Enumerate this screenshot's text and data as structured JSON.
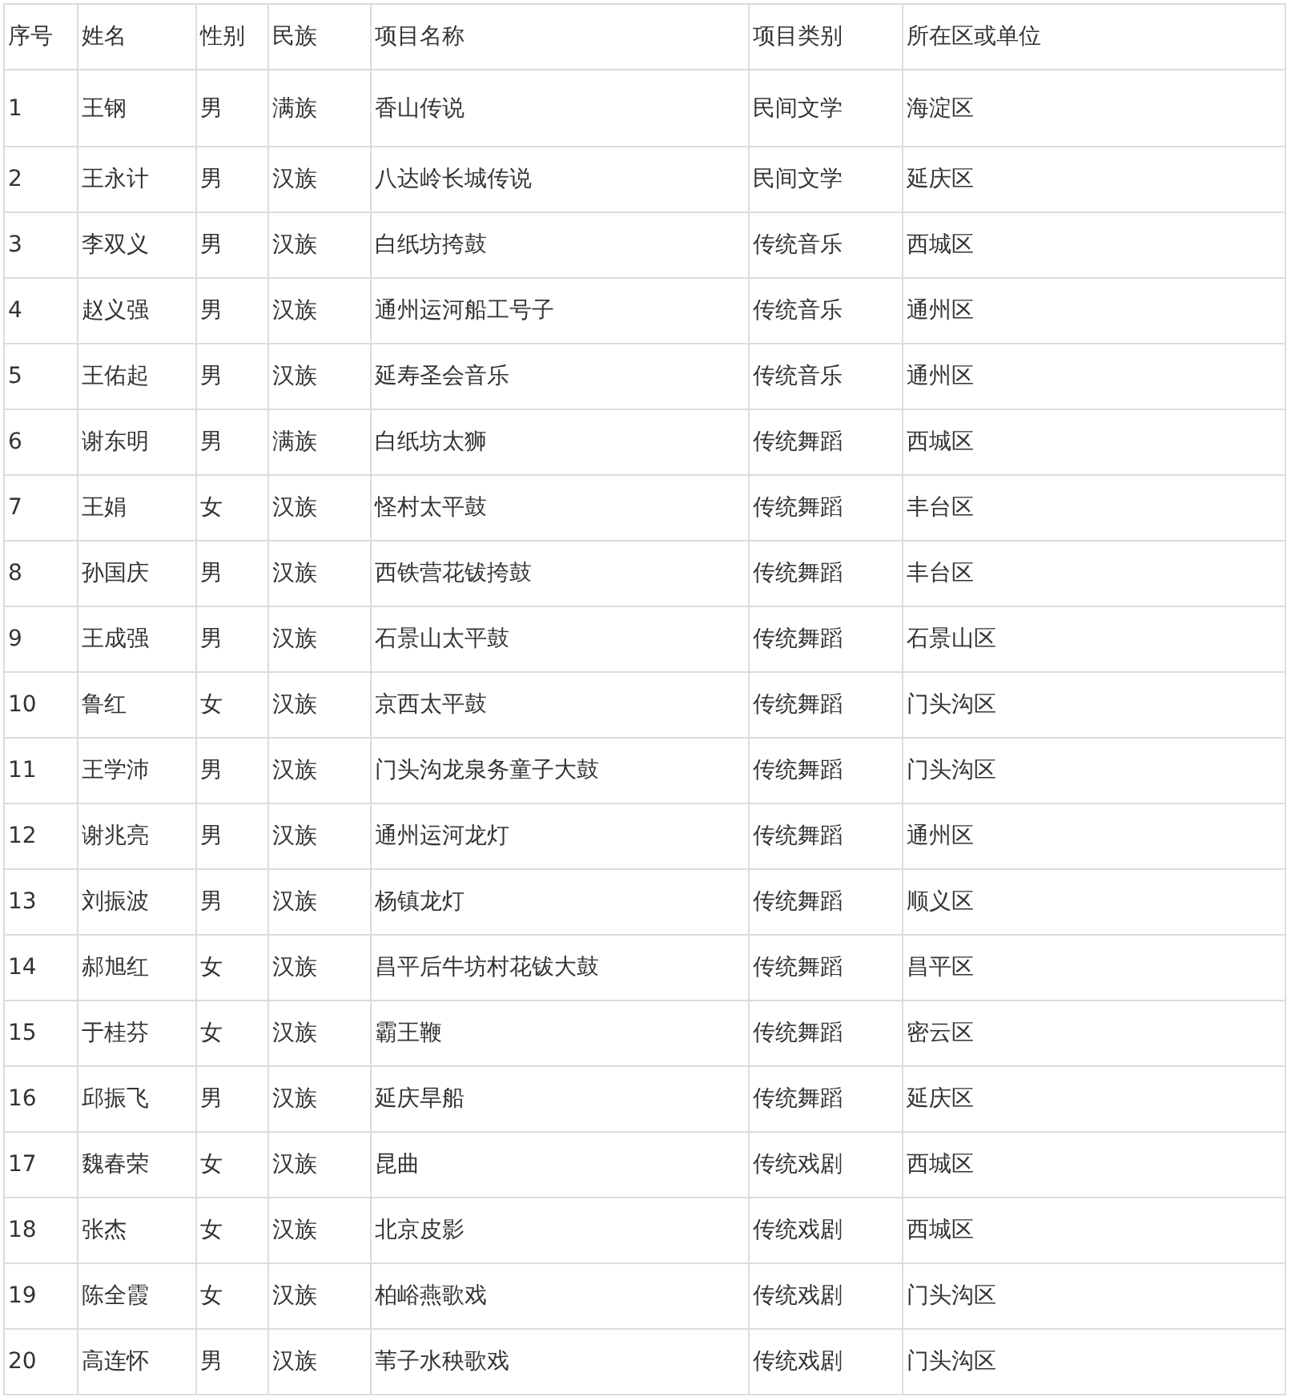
{
  "table": {
    "columns": [
      "序号",
      "姓名",
      "性别",
      "民族",
      "项目名称",
      "项目类别",
      "所在区或单位"
    ],
    "rows": [
      [
        "1",
        "王钢",
        "男",
        "满族",
        "香山传说",
        "民间文学",
        "海淀区"
      ],
      [
        "2",
        "王永计",
        "男",
        "汉族",
        "八达岭长城传说",
        "民间文学",
        "延庆区"
      ],
      [
        "3",
        "李双义",
        "男",
        "汉族",
        "白纸坊挎鼓",
        "传统音乐",
        "西城区"
      ],
      [
        "4",
        "赵义强",
        "男",
        "汉族",
        "通州运河船工号子",
        "传统音乐",
        "通州区"
      ],
      [
        "5",
        "王佑起",
        "男",
        "汉族",
        "延寿圣会音乐",
        "传统音乐",
        "通州区"
      ],
      [
        "6",
        "谢东明",
        "男",
        "满族",
        "白纸坊太狮",
        "传统舞蹈",
        "西城区"
      ],
      [
        "7",
        "王娟",
        "女",
        "汉族",
        "怪村太平鼓",
        "传统舞蹈",
        "丰台区"
      ],
      [
        "8",
        "孙国庆",
        "男",
        "汉族",
        "西铁营花钹挎鼓",
        "传统舞蹈",
        "丰台区"
      ],
      [
        "9",
        "王成强",
        "男",
        "汉族",
        "石景山太平鼓",
        "传统舞蹈",
        "石景山区"
      ],
      [
        "10",
        "鲁红",
        "女",
        "汉族",
        "京西太平鼓",
        "传统舞蹈",
        "门头沟区"
      ],
      [
        "11",
        "王学沛",
        "男",
        "汉族",
        "门头沟龙泉务童子大鼓",
        "传统舞蹈",
        "门头沟区"
      ],
      [
        "12",
        "谢兆亮",
        "男",
        "汉族",
        "通州运河龙灯",
        "传统舞蹈",
        "通州区"
      ],
      [
        "13",
        "刘振波",
        "男",
        "汉族",
        "杨镇龙灯",
        "传统舞蹈",
        "顺义区"
      ],
      [
        "14",
        "郝旭红",
        "女",
        "汉族",
        "昌平后牛坊村花钹大鼓",
        "传统舞蹈",
        "昌平区"
      ],
      [
        "15",
        "于桂芬",
        "女",
        "汉族",
        "霸王鞭",
        "传统舞蹈",
        "密云区"
      ],
      [
        "16",
        "邱振飞",
        "男",
        "汉族",
        "延庆旱船",
        "传统舞蹈",
        "延庆区"
      ],
      [
        "17",
        "魏春荣",
        "女",
        "汉族",
        "昆曲",
        "传统戏剧",
        "西城区"
      ],
      [
        "18",
        "张杰",
        "女",
        "汉族",
        "北京皮影",
        "传统戏剧",
        "西城区"
      ],
      [
        "19",
        "陈全霞",
        "女",
        "汉族",
        "柏峪燕歌戏",
        "传统戏剧",
        "门头沟区"
      ],
      [
        "20",
        "高连怀",
        "男",
        "汉族",
        "苇子水秧歌戏",
        "传统戏剧",
        "门头沟区"
      ]
    ]
  }
}
